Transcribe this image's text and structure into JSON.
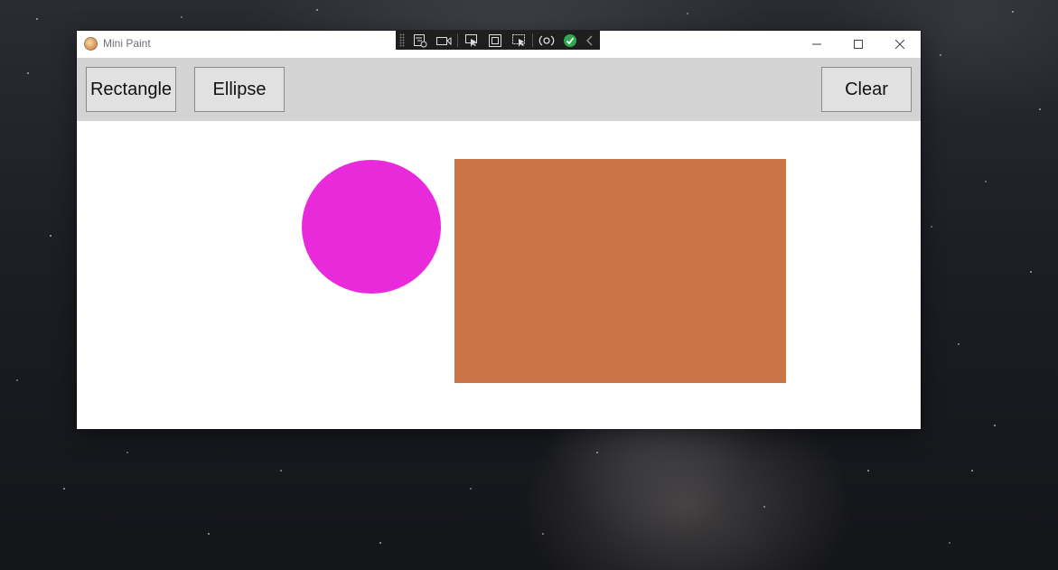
{
  "window": {
    "title": "Mini Paint",
    "controls": {
      "minimize": "minimize-icon",
      "maximize": "maximize-icon",
      "close": "close-icon"
    }
  },
  "debug_toolbar": {
    "buttons": [
      "live-visual-tree-icon",
      "video-camera-icon",
      "select-element-icon",
      "display-layout-adorners-icon",
      "track-focus-icon",
      "hot-reload-icon",
      "binding-check-icon",
      "collapse-chevron-icon"
    ]
  },
  "toolbar": {
    "rectangle_label": "Rectangle",
    "ellipse_label": "Ellipse",
    "clear_label": "Clear",
    "background": "#d3d3d3"
  },
  "canvas": {
    "background": "#ffffff",
    "shapes": [
      {
        "type": "ellipse",
        "color": "#e92adb"
      },
      {
        "type": "rectangle",
        "color": "#cb7446"
      }
    ]
  }
}
